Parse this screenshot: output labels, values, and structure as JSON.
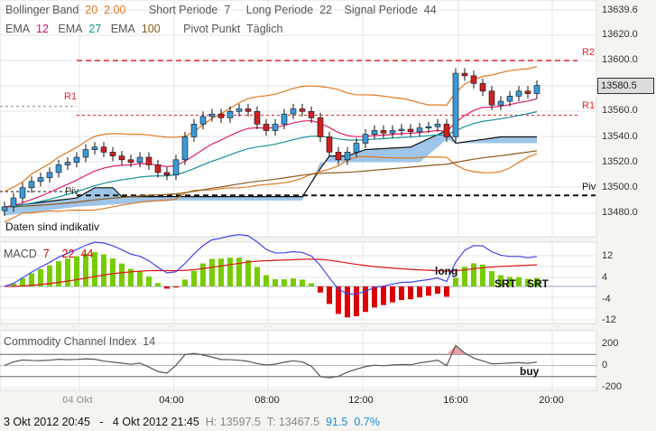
{
  "header": {
    "bb_label": "Bollinger Band",
    "bb_period": "20",
    "bb_dev": "2.00",
    "short_label": "Short Periode",
    "short_val": "7",
    "long_label": "Long Periode",
    "long_val": "22",
    "signal_label": "Signal Periode",
    "signal_val": "44",
    "ema1_label": "EMA",
    "ema1_val": "12",
    "ema2_label": "EMA",
    "ema2_val": "27",
    "ema3_label": "EMA",
    "ema3_val": "100",
    "pivot_label": "Pivot Punkt",
    "pivot_val": "Täglich"
  },
  "main": {
    "note": "Daten sind indikativ",
    "current_price": "13580.5",
    "r2_label": "R2",
    "r1_label": "R1",
    "r1_left_label": "R1",
    "piv_label": "Piv",
    "piv_left_label": "Piv",
    "y_ticks": [
      "13639.6",
      "13620.0",
      "13600.0",
      "13560.0",
      "13540.0",
      "13520.0",
      "13500.0",
      "13480.0"
    ]
  },
  "macd": {
    "label": "MACD",
    "p1": "7",
    "p2": "22",
    "p3": "44",
    "y_ticks": [
      "12",
      "4",
      "-4",
      "-12"
    ],
    "annot_long": "long",
    "annot_srt1": "SRT",
    "annot_srt2": "SRT"
  },
  "cci": {
    "label": "Commodity Channel Index",
    "period": "14",
    "y_ticks": [
      "200",
      "0",
      "-200"
    ],
    "annot_buy": "buy"
  },
  "x_axis": {
    "ticks": [
      "04 Okt",
      "04:00",
      "08:00",
      "12:00",
      "16:00",
      "20:00"
    ]
  },
  "footer": {
    "from": "3 Okt 2012 20:45",
    "sep": "-",
    "to": "4 Okt 2012 21:45",
    "high": "H: 13597.5",
    "low": "T: 13467.5",
    "change": "91.5",
    "change_pct": "0.7%"
  },
  "colors": {
    "up": "#3a9ad9",
    "down": "#cc2222",
    "bb": "#e07820",
    "ema12": "#e0206a",
    "ema27": "#17909a",
    "ema100": "#8a5a1a",
    "macd_line": "#4444ee",
    "signal": "#dd1111",
    "hist_pos": "#77cc00",
    "hist_neg": "#dd0000",
    "cloud": "#9fc5e8",
    "pivot_r": "#ee2222"
  },
  "chart_data": {
    "type": "line",
    "title": "Price (candlestick) with Bollinger, EMA, Pivot, MACD, CCI",
    "ylim": [
      13470,
      13645
    ],
    "close": [
      13485,
      13492,
      13500,
      13505,
      13508,
      13512,
      13518,
      13520,
      13524,
      13530,
      13532,
      13528,
      13525,
      13522,
      13520,
      13524,
      13518,
      13512,
      13510,
      13522,
      13540,
      13550,
      13556,
      13558,
      13555,
      13560,
      13562,
      13560,
      13550,
      13545,
      13550,
      13558,
      13562,
      13560,
      13555,
      13540,
      13528,
      13522,
      13528,
      13535,
      13542,
      13545,
      13543,
      13545,
      13546,
      13544,
      13547,
      13548,
      13550,
      13540,
      13590,
      13588,
      13582,
      13576,
      13565,
      13568,
      13572,
      13576,
      13574,
      13580.5
    ],
    "pivots": {
      "R2": 13600,
      "R1": 13557,
      "R1_prev": 13564,
      "Piv": 13494,
      "Piv_prev": 13497
    },
    "cloud_top": [
      [
        0,
        13485
      ],
      [
        8,
        13492
      ],
      [
        10,
        13500
      ],
      [
        12,
        13500
      ],
      [
        13,
        13493
      ],
      [
        33,
        13493
      ],
      [
        35,
        13515
      ],
      [
        36,
        13525
      ],
      [
        38,
        13525
      ],
      [
        40,
        13530
      ],
      [
        45,
        13532
      ],
      [
        49,
        13545
      ],
      [
        50,
        13535
      ],
      [
        55,
        13540
      ],
      [
        59,
        13540
      ]
    ],
    "cloud_bottom": [
      [
        0,
        13478
      ],
      [
        8,
        13485
      ],
      [
        19,
        13490
      ],
      [
        33,
        13490
      ],
      [
        35,
        13520
      ],
      [
        46,
        13520
      ],
      [
        49,
        13538
      ],
      [
        50,
        13535
      ],
      [
        59,
        13535
      ]
    ],
    "macd_ylim": [
      -14,
      14
    ],
    "cci_ylim": [
      -220,
      220
    ]
  }
}
